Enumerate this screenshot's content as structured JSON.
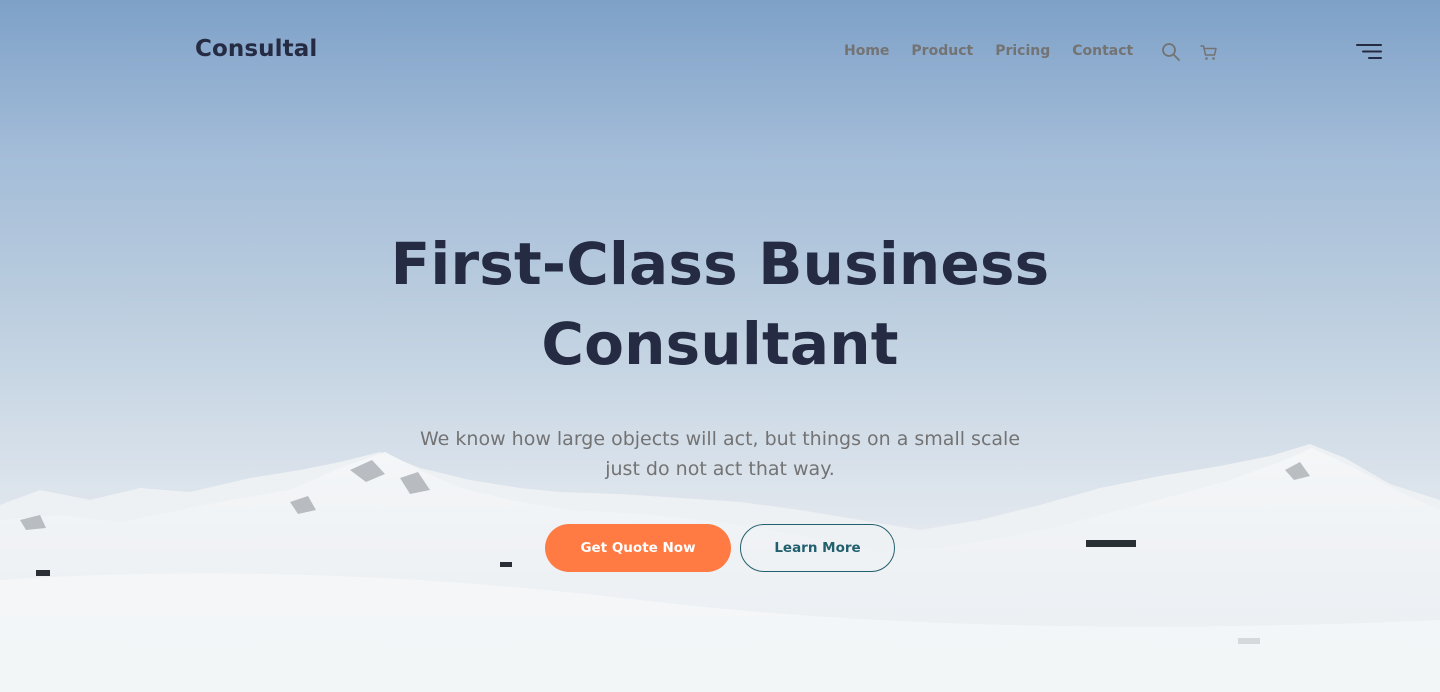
{
  "brand": {
    "name": "Consultal"
  },
  "nav": {
    "items": [
      {
        "label": "Home"
      },
      {
        "label": "Product"
      },
      {
        "label": "Pricing"
      },
      {
        "label": "Contact"
      }
    ],
    "icons": [
      "search-icon",
      "cart-icon",
      "menu-icon"
    ]
  },
  "hero": {
    "title_line1": "First-Class Business",
    "title_line2": "Consultant",
    "subtitle": "We know how large objects will act, but things on a small scale just do not act that way.",
    "primary_cta": "Get Quote Now",
    "secondary_cta": "Learn More"
  },
  "colors": {
    "text_dark": "#252B42",
    "text_muted": "#737373",
    "accent": "#FF7B43",
    "secondary": "#23606E"
  }
}
